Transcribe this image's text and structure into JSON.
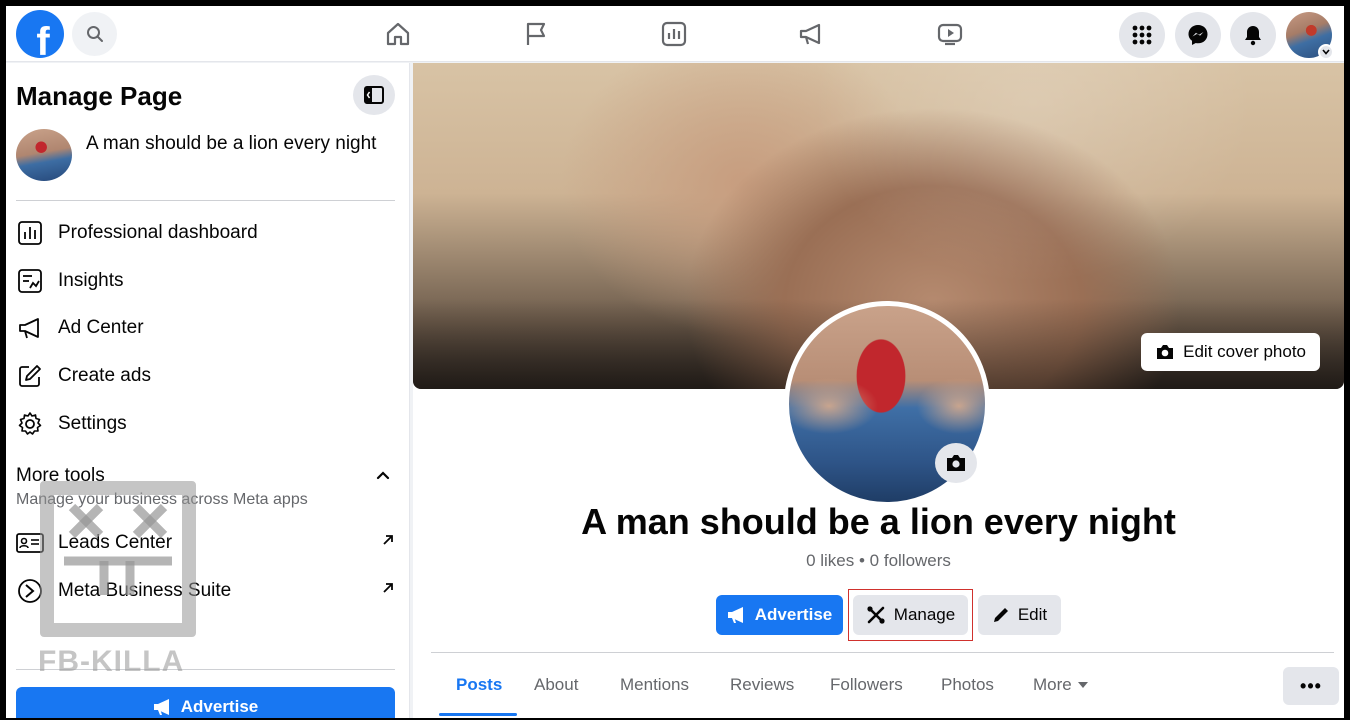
{
  "topbar": {
    "logo_letter": "f",
    "nav": [
      "home-icon",
      "flag-icon",
      "chart-icon",
      "megaphone-icon",
      "video-icon"
    ],
    "right": [
      "menu-grid-icon",
      "messenger-icon",
      "bell-icon"
    ]
  },
  "sidebar": {
    "title": "Manage Page",
    "page_name": "A man should be a lion every night",
    "items": [
      {
        "label": "Professional dashboard",
        "icon": "dashboard-icon"
      },
      {
        "label": "Insights",
        "icon": "insights-icon"
      },
      {
        "label": "Ad Center",
        "icon": "megaphone-icon"
      },
      {
        "label": "Create ads",
        "icon": "edit-icon"
      },
      {
        "label": "Settings",
        "icon": "gear-icon"
      }
    ],
    "more_tools": {
      "title": "More tools",
      "subtitle": "Manage your business across Meta apps",
      "items": [
        {
          "label": "Leads Center",
          "icon": "id-card-icon"
        },
        {
          "label": "Meta Business Suite",
          "icon": "meta-business-icon"
        }
      ]
    },
    "advertise_label": "Advertise",
    "watermark": "FB-KILLA"
  },
  "main": {
    "edit_cover_label": "Edit cover photo",
    "page_name": "A man should be a lion every night",
    "stats": "0 likes • 0 followers",
    "buttons": {
      "advertise": "Advertise",
      "manage": "Manage",
      "edit": "Edit"
    },
    "tabs": [
      "Posts",
      "About",
      "Mentions",
      "Reviews",
      "Followers",
      "Photos",
      "More"
    ],
    "more_dots": "•••",
    "accent": "#1877f2"
  }
}
